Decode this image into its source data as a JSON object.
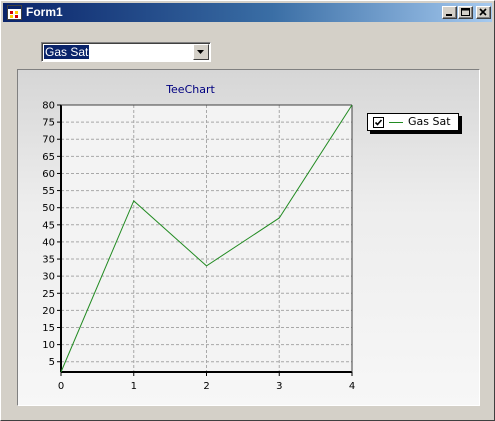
{
  "window": {
    "title": "Form1",
    "icon": "form-icon",
    "buttons": [
      "minimize-icon",
      "maximize-icon",
      "close-icon"
    ]
  },
  "series_selector": {
    "selected": "Gas Sat",
    "icon": "chevron-down-icon"
  },
  "chart_data": {
    "type": "line",
    "title": "TeeChart",
    "xlabel": "",
    "ylabel": "",
    "x": [
      0,
      1,
      2,
      3,
      4
    ],
    "xticks": [
      "0",
      "1",
      "2",
      "3",
      "4"
    ],
    "yticks": [
      "5",
      "10",
      "15",
      "20",
      "25",
      "30",
      "35",
      "40",
      "45",
      "50",
      "55",
      "60",
      "65",
      "70",
      "75",
      "80"
    ],
    "xlim": [
      0,
      4
    ],
    "ylim": [
      2,
      80
    ],
    "grid": true,
    "legend": "right",
    "series": [
      {
        "name": "Gas Sat",
        "color": "#228b22",
        "values": [
          2,
          52,
          33,
          47,
          80
        ],
        "checked": true
      }
    ]
  }
}
